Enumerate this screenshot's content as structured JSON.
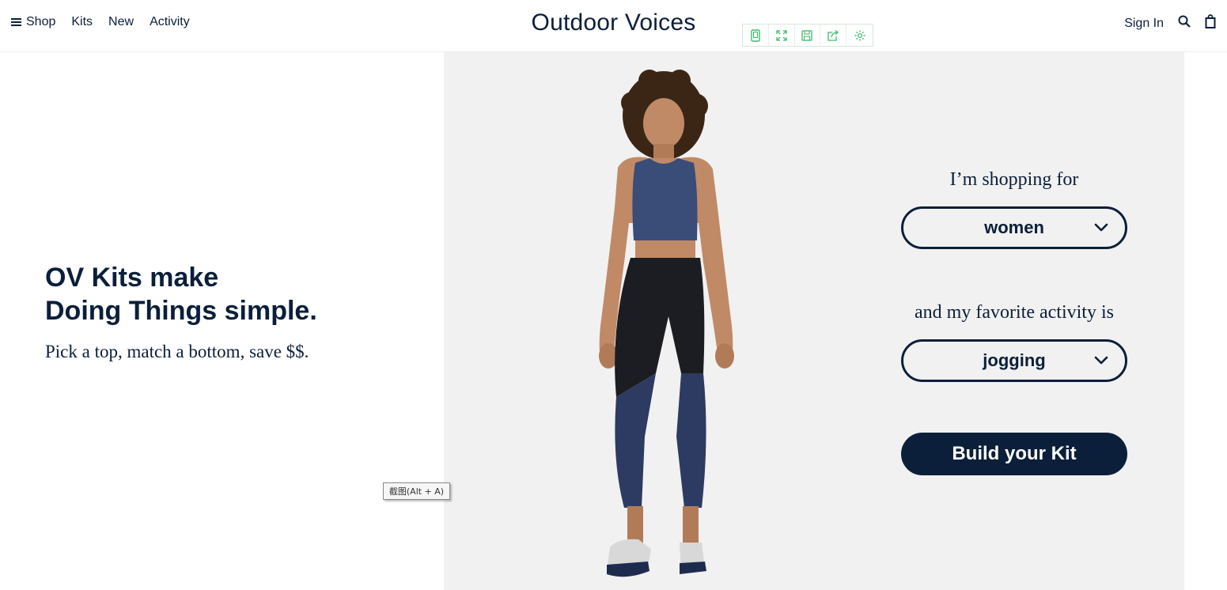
{
  "nav": {
    "left_items": [
      "Shop",
      "Kits",
      "New",
      "Activity"
    ],
    "brand": "Outdoor Voices",
    "sign_in": "Sign In",
    "icons": [
      "menu-icon",
      "search-icon",
      "shopping-bag-icon"
    ]
  },
  "toolbar": {
    "icons": [
      "tablet-icon",
      "fullscreen-icon",
      "save-icon",
      "share-icon",
      "settings-icon"
    ],
    "accent": "#3dbb6b"
  },
  "hero": {
    "headline_line1": "OV Kits make",
    "headline_line2": "Doing Things simple.",
    "subline": "Pick a top, match a bottom, save $$."
  },
  "form": {
    "shopping_label": "I’m shopping for",
    "shopping_value": "women",
    "activity_label": "and my favorite activity is",
    "activity_value": "jogging",
    "cta": "Build your Kit"
  },
  "tooltip": "截图(Alt + A)",
  "colors": {
    "navy": "#0b1f3a",
    "panel_bg": "#f1f1f1"
  }
}
